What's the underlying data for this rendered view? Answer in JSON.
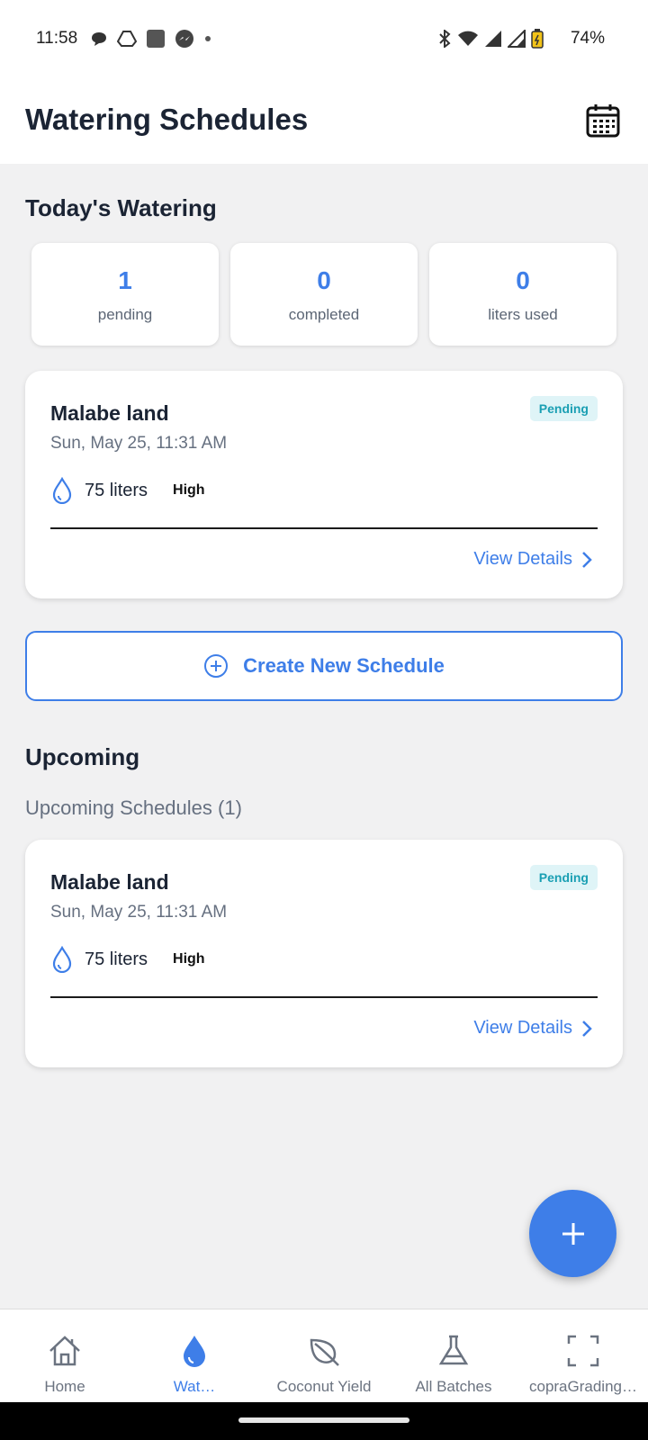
{
  "status_bar": {
    "time": "11:58",
    "battery": "74%",
    "left_icons": [
      "chat-bubble-icon",
      "drive-icon",
      "square-app-icon",
      "messenger-icon",
      "dot-icon"
    ],
    "right_icons": [
      "bluetooth-icon",
      "wifi-icon",
      "signal-icon",
      "signal-icon",
      "battery-icon"
    ]
  },
  "header": {
    "title": "Watering Schedules",
    "calendar_icon": "calendar-icon"
  },
  "today": {
    "title": "Today's Watering",
    "stats": [
      {
        "value": "1",
        "label": "pending"
      },
      {
        "value": "0",
        "label": "completed"
      },
      {
        "value": "0",
        "label": "liters used"
      }
    ],
    "schedule": {
      "name": "Malabe land",
      "date": "Sun, May 25, 11:31 AM",
      "status": "Pending",
      "liters": "75 liters",
      "priority": "High",
      "view_label": "View Details"
    }
  },
  "create_button": {
    "label": "Create New Schedule"
  },
  "upcoming": {
    "title": "Upcoming",
    "subtitle": "Upcoming Schedules (1)",
    "schedule": {
      "name": "Malabe land",
      "date": "Sun, May 25, 11:31 AM",
      "status": "Pending",
      "liters": "75 liters",
      "priority": "High",
      "view_label": "View Details"
    }
  },
  "nav": {
    "items": [
      {
        "label": "Home",
        "icon": "home-icon"
      },
      {
        "label": "Wat…",
        "icon": "water-drop-icon"
      },
      {
        "label": "Coconut Yield",
        "icon": "leaf-icon"
      },
      {
        "label": "All Batches",
        "icon": "flask-icon"
      },
      {
        "label": "copraGrading…",
        "icon": "scan-frame-icon"
      }
    ],
    "active_index": 1
  },
  "colors": {
    "accent": "#3e7ee8",
    "badge_bg": "#dff4f7",
    "badge_text": "#1a9fb3",
    "background": "#f1f1f2"
  }
}
